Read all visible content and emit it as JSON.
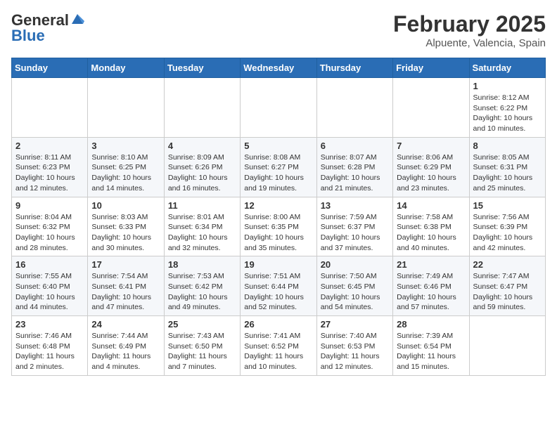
{
  "header": {
    "logo_line1": "General",
    "logo_line2": "Blue",
    "month_title": "February 2025",
    "subtitle": "Alpuente, Valencia, Spain"
  },
  "weekdays": [
    "Sunday",
    "Monday",
    "Tuesday",
    "Wednesday",
    "Thursday",
    "Friday",
    "Saturday"
  ],
  "weeks": [
    [
      {
        "day": "",
        "info": ""
      },
      {
        "day": "",
        "info": ""
      },
      {
        "day": "",
        "info": ""
      },
      {
        "day": "",
        "info": ""
      },
      {
        "day": "",
        "info": ""
      },
      {
        "day": "",
        "info": ""
      },
      {
        "day": "1",
        "info": "Sunrise: 8:12 AM\nSunset: 6:22 PM\nDaylight: 10 hours\nand 10 minutes."
      }
    ],
    [
      {
        "day": "2",
        "info": "Sunrise: 8:11 AM\nSunset: 6:23 PM\nDaylight: 10 hours\nand 12 minutes."
      },
      {
        "day": "3",
        "info": "Sunrise: 8:10 AM\nSunset: 6:25 PM\nDaylight: 10 hours\nand 14 minutes."
      },
      {
        "day": "4",
        "info": "Sunrise: 8:09 AM\nSunset: 6:26 PM\nDaylight: 10 hours\nand 16 minutes."
      },
      {
        "day": "5",
        "info": "Sunrise: 8:08 AM\nSunset: 6:27 PM\nDaylight: 10 hours\nand 19 minutes."
      },
      {
        "day": "6",
        "info": "Sunrise: 8:07 AM\nSunset: 6:28 PM\nDaylight: 10 hours\nand 21 minutes."
      },
      {
        "day": "7",
        "info": "Sunrise: 8:06 AM\nSunset: 6:29 PM\nDaylight: 10 hours\nand 23 minutes."
      },
      {
        "day": "8",
        "info": "Sunrise: 8:05 AM\nSunset: 6:31 PM\nDaylight: 10 hours\nand 25 minutes."
      }
    ],
    [
      {
        "day": "9",
        "info": "Sunrise: 8:04 AM\nSunset: 6:32 PM\nDaylight: 10 hours\nand 28 minutes."
      },
      {
        "day": "10",
        "info": "Sunrise: 8:03 AM\nSunset: 6:33 PM\nDaylight: 10 hours\nand 30 minutes."
      },
      {
        "day": "11",
        "info": "Sunrise: 8:01 AM\nSunset: 6:34 PM\nDaylight: 10 hours\nand 32 minutes."
      },
      {
        "day": "12",
        "info": "Sunrise: 8:00 AM\nSunset: 6:35 PM\nDaylight: 10 hours\nand 35 minutes."
      },
      {
        "day": "13",
        "info": "Sunrise: 7:59 AM\nSunset: 6:37 PM\nDaylight: 10 hours\nand 37 minutes."
      },
      {
        "day": "14",
        "info": "Sunrise: 7:58 AM\nSunset: 6:38 PM\nDaylight: 10 hours\nand 40 minutes."
      },
      {
        "day": "15",
        "info": "Sunrise: 7:56 AM\nSunset: 6:39 PM\nDaylight: 10 hours\nand 42 minutes."
      }
    ],
    [
      {
        "day": "16",
        "info": "Sunrise: 7:55 AM\nSunset: 6:40 PM\nDaylight: 10 hours\nand 44 minutes."
      },
      {
        "day": "17",
        "info": "Sunrise: 7:54 AM\nSunset: 6:41 PM\nDaylight: 10 hours\nand 47 minutes."
      },
      {
        "day": "18",
        "info": "Sunrise: 7:53 AM\nSunset: 6:42 PM\nDaylight: 10 hours\nand 49 minutes."
      },
      {
        "day": "19",
        "info": "Sunrise: 7:51 AM\nSunset: 6:44 PM\nDaylight: 10 hours\nand 52 minutes."
      },
      {
        "day": "20",
        "info": "Sunrise: 7:50 AM\nSunset: 6:45 PM\nDaylight: 10 hours\nand 54 minutes."
      },
      {
        "day": "21",
        "info": "Sunrise: 7:49 AM\nSunset: 6:46 PM\nDaylight: 10 hours\nand 57 minutes."
      },
      {
        "day": "22",
        "info": "Sunrise: 7:47 AM\nSunset: 6:47 PM\nDaylight: 10 hours\nand 59 minutes."
      }
    ],
    [
      {
        "day": "23",
        "info": "Sunrise: 7:46 AM\nSunset: 6:48 PM\nDaylight: 11 hours\nand 2 minutes."
      },
      {
        "day": "24",
        "info": "Sunrise: 7:44 AM\nSunset: 6:49 PM\nDaylight: 11 hours\nand 4 minutes."
      },
      {
        "day": "25",
        "info": "Sunrise: 7:43 AM\nSunset: 6:50 PM\nDaylight: 11 hours\nand 7 minutes."
      },
      {
        "day": "26",
        "info": "Sunrise: 7:41 AM\nSunset: 6:52 PM\nDaylight: 11 hours\nand 10 minutes."
      },
      {
        "day": "27",
        "info": "Sunrise: 7:40 AM\nSunset: 6:53 PM\nDaylight: 11 hours\nand 12 minutes."
      },
      {
        "day": "28",
        "info": "Sunrise: 7:39 AM\nSunset: 6:54 PM\nDaylight: 11 hours\nand 15 minutes."
      },
      {
        "day": "",
        "info": ""
      }
    ]
  ]
}
